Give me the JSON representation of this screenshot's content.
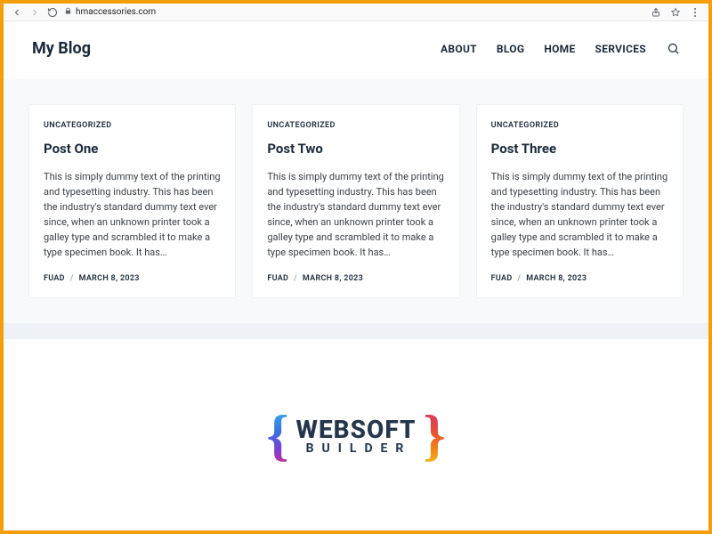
{
  "browser": {
    "url_host": "hmaccessories.com"
  },
  "header": {
    "site_title": "My Blog",
    "nav": [
      {
        "label": "ABOUT"
      },
      {
        "label": "BLOG"
      },
      {
        "label": "HOME"
      },
      {
        "label": "SERVICES"
      }
    ]
  },
  "posts": [
    {
      "category": "UNCATEGORIZED",
      "title": "Post One",
      "excerpt": "This is simply dummy text of the printing and typesetting industry. This has been the industry's standard dummy text ever since, when an unknown printer took a galley type and scrambled it to make a type specimen book. It has…",
      "author": "FUAD",
      "date": "MARCH 8, 2023"
    },
    {
      "category": "UNCATEGORIZED",
      "title": "Post Two",
      "excerpt": "This is simply dummy text of the printing and typesetting industry. This has been the industry's standard dummy text ever since, when an unknown printer took a galley type and scrambled it to make a type specimen book. It has…",
      "author": "FUAD",
      "date": "MARCH 8, 2023"
    },
    {
      "category": "UNCATEGORIZED",
      "title": "Post Three",
      "excerpt": "This is simply dummy text of the printing and typesetting industry. This has been the industry's standard dummy text ever since, when an unknown printer took a galley type and scrambled it to make a type specimen book. It has…",
      "author": "FUAD",
      "date": "MARCH 8, 2023"
    }
  ],
  "footer": {
    "logo_line1": "WEBSOFT",
    "logo_line2": "BUILDER"
  }
}
